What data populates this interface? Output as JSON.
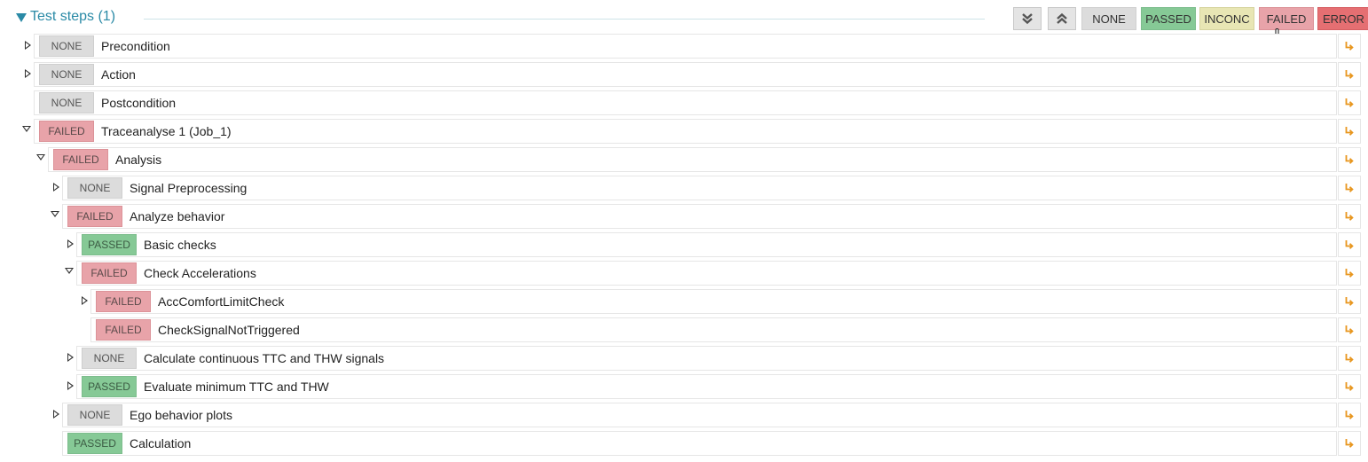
{
  "header": {
    "section_title": "Test steps (1)",
    "expand_all_icon": "double-chevron-down-icon",
    "collapse_all_icon": "double-chevron-up-icon",
    "filters": [
      {
        "label": "NONE",
        "status": "none"
      },
      {
        "label": "PASSED",
        "status": "passed"
      },
      {
        "label": "INCONC",
        "status": "inconc"
      },
      {
        "label": "FAILED",
        "status": "failed"
      },
      {
        "label": "ERROR",
        "status": "error"
      }
    ]
  },
  "status_colors": {
    "NONE": "#dcdcdc",
    "PASSED": "#86c996",
    "INCONC": "#e8e6b4",
    "FAILED": "#e8a3a9",
    "ERROR": "#e56f72",
    "accent": "#2a8aa6",
    "jump_icon": "#e8961e"
  },
  "steps": [
    {
      "status": "NONE",
      "label": "Precondition",
      "depth": 0,
      "expander": "closed"
    },
    {
      "status": "NONE",
      "label": "Action",
      "depth": 0,
      "expander": "closed"
    },
    {
      "status": "NONE",
      "label": "Postcondition",
      "depth": 0,
      "expander": "none"
    },
    {
      "status": "FAILED",
      "label": "Traceanalyse 1 (Job_1)",
      "depth": 0,
      "expander": "open"
    },
    {
      "status": "FAILED",
      "label": "Analysis",
      "depth": 1,
      "expander": "open"
    },
    {
      "status": "NONE",
      "label": "Signal Preprocessing",
      "depth": 2,
      "expander": "closed"
    },
    {
      "status": "FAILED",
      "label": "Analyze behavior",
      "depth": 2,
      "expander": "open"
    },
    {
      "status": "PASSED",
      "label": "Basic checks",
      "depth": 3,
      "expander": "closed"
    },
    {
      "status": "FAILED",
      "label": "Check Accelerations",
      "depth": 3,
      "expander": "open"
    },
    {
      "status": "FAILED",
      "label": "AccComfortLimitCheck",
      "depth": 4,
      "expander": "closed"
    },
    {
      "status": "FAILED",
      "label": "CheckSignalNotTriggered",
      "depth": 4,
      "expander": "none"
    },
    {
      "status": "NONE",
      "label": "Calculate continuous TTC and THW signals",
      "depth": 3,
      "expander": "closed"
    },
    {
      "status": "PASSED",
      "label": "Evaluate minimum TTC and THW",
      "depth": 3,
      "expander": "closed"
    },
    {
      "status": "NONE",
      "label": "Ego behavior plots",
      "depth": 2,
      "expander": "closed"
    },
    {
      "status": "PASSED",
      "label": "Calculation",
      "depth": 2,
      "expander": "none"
    }
  ],
  "row_action_icon": "jump-to-step-icon"
}
